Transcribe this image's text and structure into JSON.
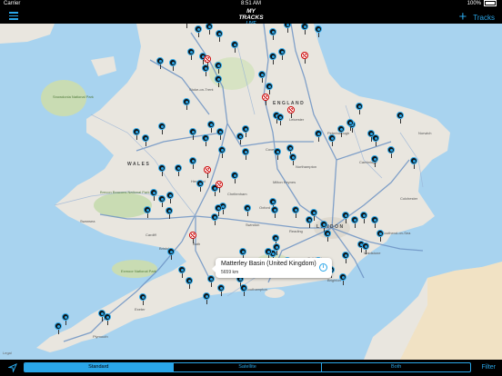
{
  "status": {
    "carrier": "Carrier",
    "time": "8:51 AM",
    "battery": "100%"
  },
  "nav": {
    "logo_top": "MY TRACKS",
    "logo_bottom": "LIVE",
    "tracks_label": "Tracks"
  },
  "map": {
    "labels": {
      "wales": "WALES",
      "england": "ENGLAND",
      "london": "LONDON",
      "snowdonia": "Snowdonia National Park",
      "brecon": "Brecon Beacons National Park",
      "exmoor": "Exmoor National Park",
      "stoke": "Stoke-on-Trent",
      "leicester": "Leicester",
      "coventry": "Coventry",
      "cambridge": "Cambridge",
      "hereford": "Hereford",
      "cheltenham": "Cheltenham",
      "swindon": "Swindon",
      "reading": "Reading",
      "cardiff": "Cardiff",
      "bristol": "Bristol",
      "plymouth": "Plymouth",
      "southampton": "Southampton",
      "milton_keynes": "Milton Keynes",
      "northampton": "Northampton",
      "oxford": "Oxford",
      "bath": "Bath",
      "guildford": "Guildford",
      "brighton": "Brighton",
      "maidstone": "Maidstone",
      "southend": "Southend-on-Sea",
      "colchester": "Colchester",
      "norwich": "Norwich",
      "peterborough": "Peterborough",
      "exeter": "Exeter",
      "swansea": "Swansea"
    }
  },
  "callout": {
    "title": "Matterley Basin (United Kingdom)",
    "distance": "5659 km",
    "info_glyph": "i"
  },
  "legal": "Legal",
  "toolbar": {
    "segments": [
      "Standard",
      "Satellite",
      "Both"
    ],
    "selected": "Standard",
    "filter_label": "Filter"
  },
  "colors": {
    "accent": "#2aa6e8",
    "bar": "#000000",
    "land": "#e9e6df",
    "water": "#a8d3ef",
    "park": "#c9dcb3",
    "race": "#cc0000"
  }
}
